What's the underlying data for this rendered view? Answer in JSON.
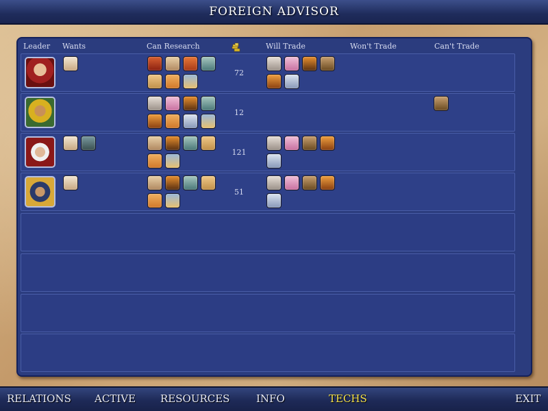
{
  "title": "FOREIGN ADVISOR",
  "columns": {
    "leader": "Leader",
    "wants": "Wants",
    "can_research": "Can Research",
    "will_trade": "Will Trade",
    "wont_trade": "Won't Trade",
    "cant_trade": "Can't Trade"
  },
  "rows": [
    {
      "gold": "72"
    },
    {
      "gold": "12"
    },
    {
      "gold": "121"
    },
    {
      "gold": "51"
    }
  ],
  "nav": {
    "relations": "RELATIONS",
    "active": "ACTIVE",
    "resources": "RESOURCES",
    "info": "INFO",
    "techs": "TECHS",
    "exit": "EXIT"
  },
  "colors": {
    "panel": "#2b3c7e",
    "active_tab": "#f4e04a",
    "parchment": "#c9a97e"
  },
  "icons": {
    "gold_column": "gold-coins-icon",
    "tech_types": [
      "scroll-tech-icon",
      "horse-tech-icon",
      "compass-tech-icon",
      "statue-tech-icon",
      "pen-tech-icon",
      "map-tech-icon",
      "dragon-tech-icon",
      "mosaic-tech-icon",
      "leaf-tech-icon",
      "temple-tech-icon"
    ]
  }
}
